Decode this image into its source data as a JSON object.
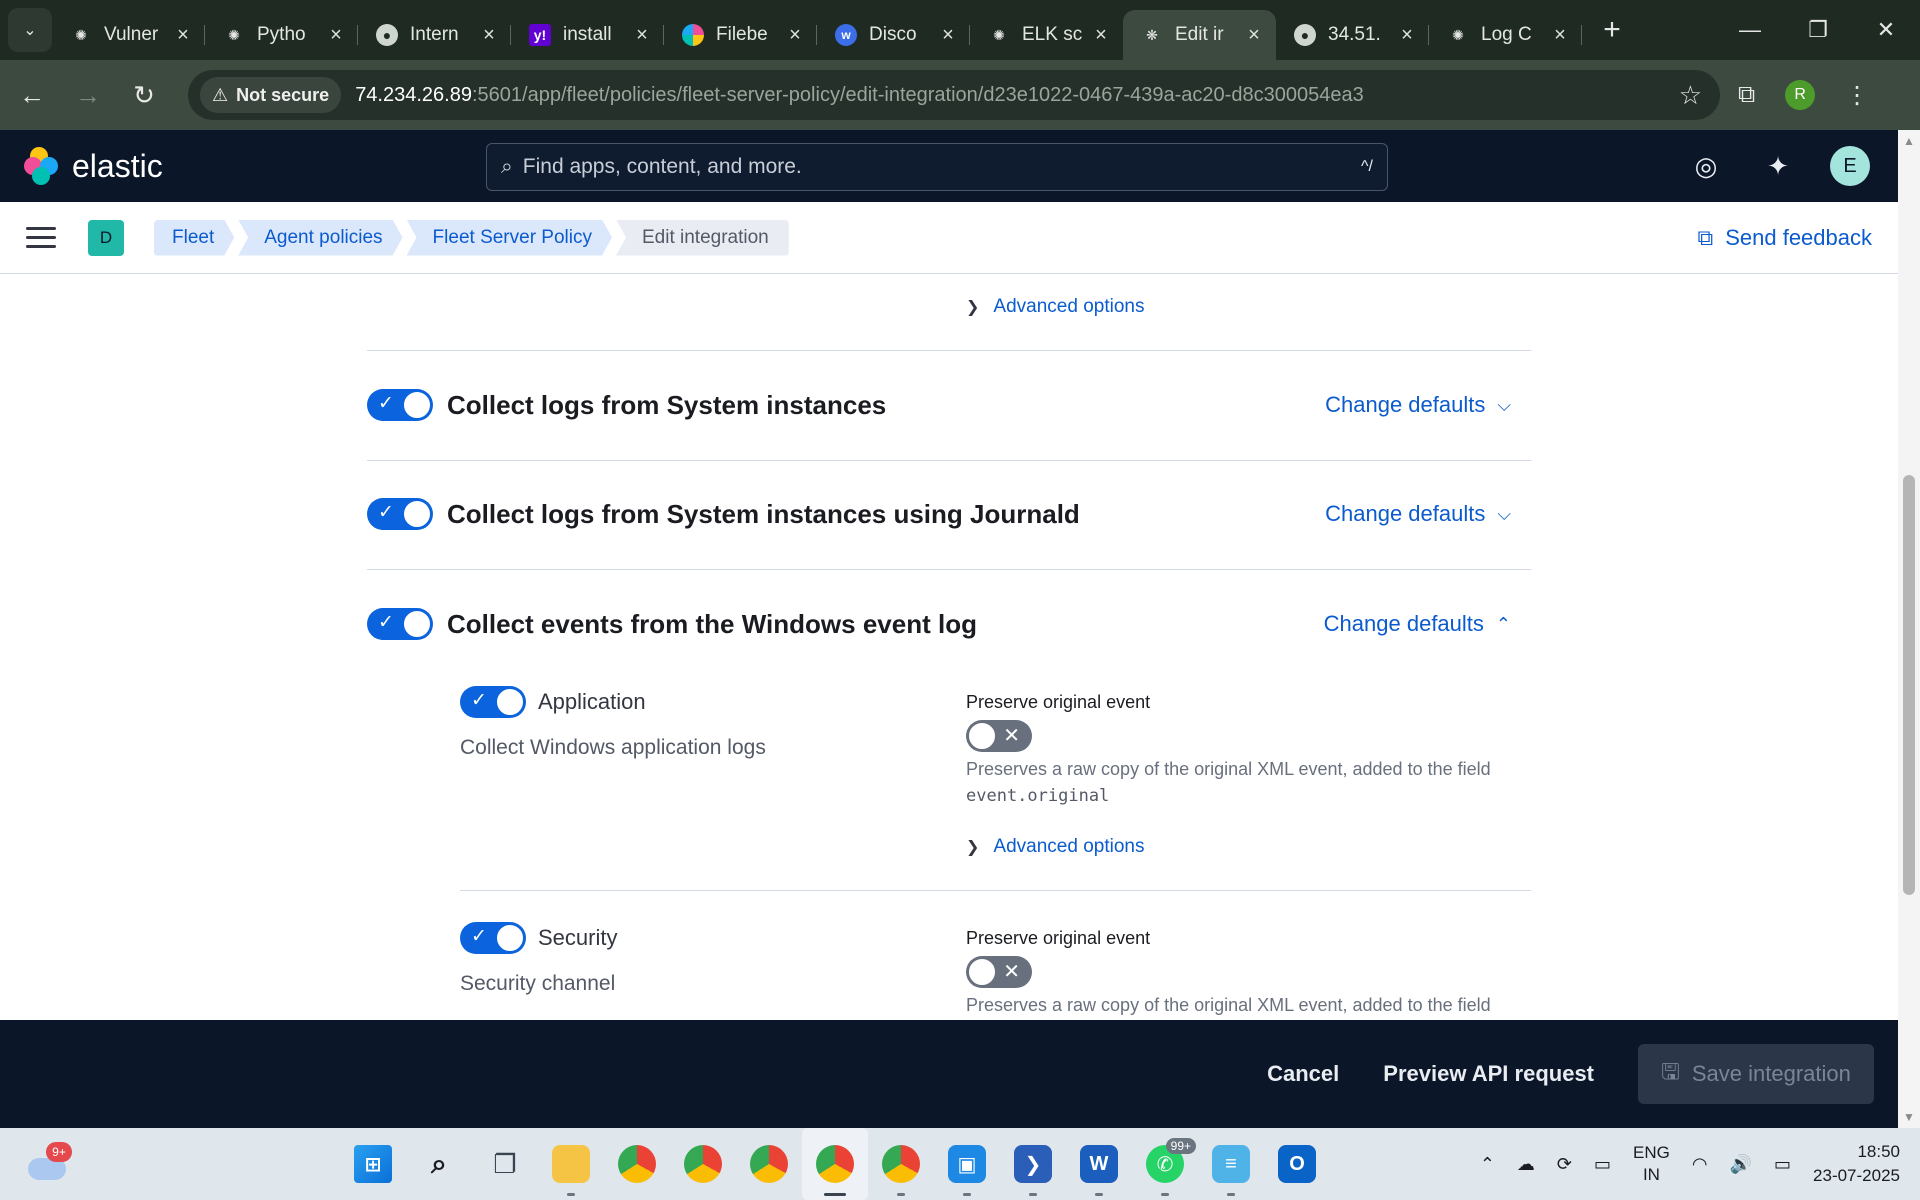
{
  "browser": {
    "tabs": [
      {
        "title": "Vulner",
        "icon": "openai-icon",
        "active": false
      },
      {
        "title": "Pytho",
        "icon": "openai-icon",
        "active": false
      },
      {
        "title": "Intern",
        "icon": "globe-icon",
        "active": false
      },
      {
        "title": "install",
        "icon": "yahoo-icon",
        "active": false
      },
      {
        "title": "Filebe",
        "icon": "elastic-icon",
        "active": false
      },
      {
        "title": "Disco",
        "icon": "w-icon",
        "active": false
      },
      {
        "title": "ELK sc",
        "icon": "openai-icon",
        "active": false
      },
      {
        "title": "Edit ir",
        "icon": "kibana-icon",
        "active": true
      },
      {
        "title": "34.51.",
        "icon": "globe-icon",
        "active": false
      },
      {
        "title": "Log C",
        "icon": "openai-icon",
        "active": false
      }
    ],
    "security_label": "Not secure",
    "url_host": "74.234.26.89",
    "url_path": ":5601/app/fleet/policies/fleet-server-policy/edit-integration/d23e1022-0467-439a-ac20-d8c300054ea3",
    "profile_initial": "R"
  },
  "kibana": {
    "logo_text": "elastic",
    "search_placeholder": "Find apps, content, and more.",
    "search_shortcut": "^/",
    "user_initial": "E",
    "space_initial": "D"
  },
  "breadcrumbs": [
    "Fleet",
    "Agent policies",
    "Fleet Server Policy",
    "Edit integration"
  ],
  "send_feedback": "Send feedback",
  "advanced_options_label": "Advanced options",
  "sections": [
    {
      "title": "Collect logs from System instances",
      "enabled": true,
      "action": "Change defaults",
      "expanded": false
    },
    {
      "title": "Collect logs from System instances using Journald",
      "enabled": true,
      "action": "Change defaults",
      "expanded": false
    },
    {
      "title": "Collect events from the Windows event log",
      "enabled": true,
      "action": "Change defaults",
      "expanded": true
    }
  ],
  "streams": [
    {
      "label": "Application",
      "enabled": true,
      "description": "Collect Windows application logs"
    },
    {
      "label": "Security",
      "enabled": true,
      "description": "Security channel"
    }
  ],
  "preserve": {
    "label": "Preserve original event",
    "enabled": false,
    "help": "Preserves a raw copy of the original XML event, added to the field",
    "help_code": "event.original"
  },
  "actions": {
    "cancel": "Cancel",
    "preview": "Preview API request",
    "save": "Save integration"
  },
  "taskbar": {
    "weather_badge": "9+",
    "whatsapp_badge": "99+",
    "lang_line1": "ENG",
    "lang_line2": "IN",
    "time": "18:50",
    "date": "23-07-2025"
  },
  "colors": {
    "primary": "#0b64dd",
    "link": "#0b5bce",
    "header_bg": "#0b1628",
    "chrome_bg": "#1f2b22"
  }
}
